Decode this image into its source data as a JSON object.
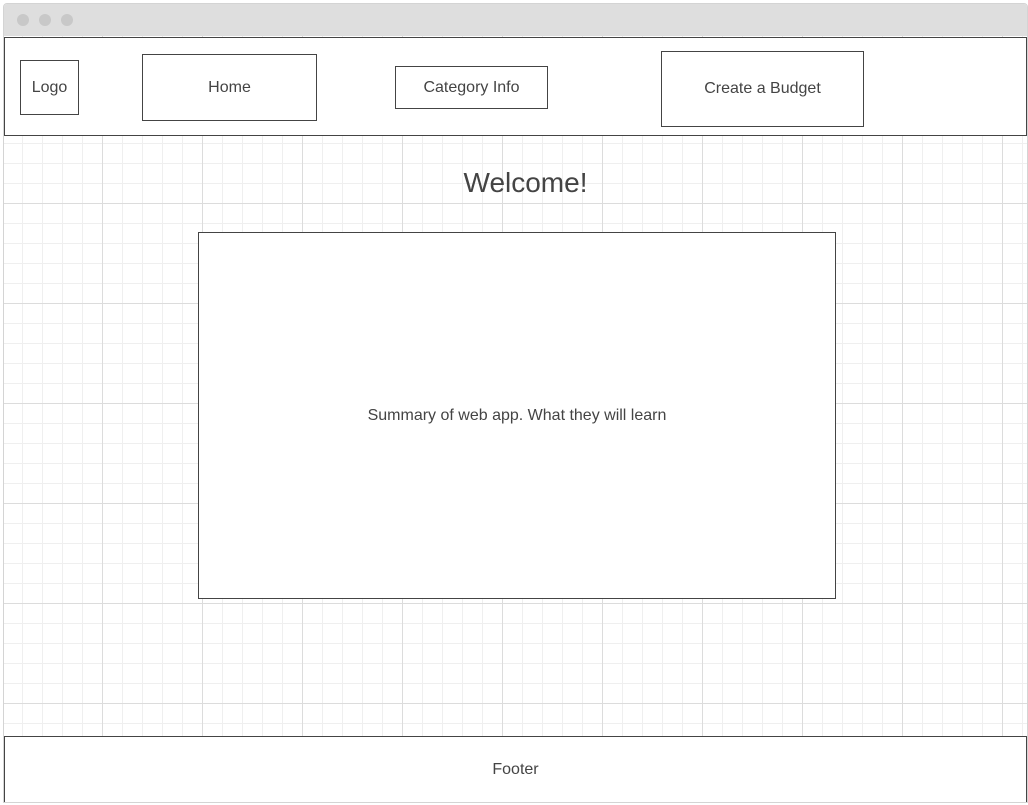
{
  "header": {
    "logo_label": "Logo",
    "nav": {
      "home_label": "Home",
      "category_label": "Category Info",
      "budget_label": "Create a Budget"
    }
  },
  "main": {
    "heading": "Welcome!",
    "summary_text": "Summary of web app. What they will learn"
  },
  "footer": {
    "label": "Footer"
  },
  "colors": {
    "border": "#444444",
    "titlebar": "#dedede",
    "grid": "#dcdcdc"
  }
}
